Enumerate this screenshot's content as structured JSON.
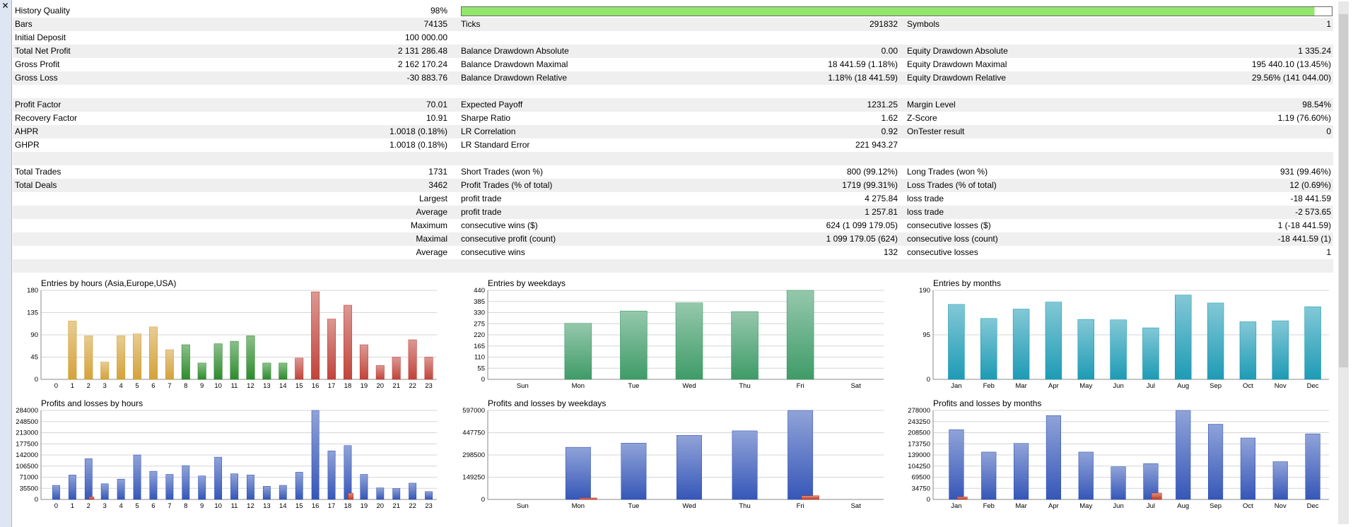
{
  "window": {
    "close_label": "✕"
  },
  "history_quality": {
    "label": "History Quality",
    "value": "98%",
    "fill_fraction": 0.98,
    "bar_color": "#93e66b"
  },
  "rows": [
    {
      "cells": [
        "Bars",
        "74135",
        "Ticks",
        "291832",
        "Symbols",
        "1"
      ]
    },
    {
      "cells": [
        "Initial Deposit",
        "100 000.00",
        "",
        "",
        "",
        ""
      ]
    },
    {
      "cells": [
        "Total Net Profit",
        "2 131 286.48",
        "Balance Drawdown Absolute",
        "0.00",
        "Equity Drawdown Absolute",
        "1 335.24"
      ]
    },
    {
      "cells": [
        "Gross Profit",
        "2 162 170.24",
        "Balance Drawdown Maximal",
        "18 441.59 (1.18%)",
        "Equity Drawdown Maximal",
        "195 440.10 (13.45%)"
      ]
    },
    {
      "cells": [
        "Gross Loss",
        "-30 883.76",
        "Balance Drawdown Relative",
        "1.18% (18 441.59)",
        "Equity Drawdown Relative",
        "29.56% (141 044.00)"
      ]
    },
    {
      "cells": [
        "",
        "",
        "",
        "",
        "",
        ""
      ]
    },
    {
      "cells": [
        "Profit Factor",
        "70.01",
        "Expected Payoff",
        "1231.25",
        "Margin Level",
        "98.54%"
      ]
    },
    {
      "cells": [
        "Recovery Factor",
        "10.91",
        "Sharpe Ratio",
        "1.62",
        "Z-Score",
        "1.19 (76.60%)"
      ]
    },
    {
      "cells": [
        "AHPR",
        "1.0018 (0.18%)",
        "LR Correlation",
        "0.92",
        "OnTester result",
        "0"
      ]
    },
    {
      "cells": [
        "GHPR",
        "1.0018 (0.18%)",
        "LR Standard Error",
        "221 943.27",
        "",
        ""
      ]
    },
    {
      "cells": [
        "",
        "",
        "",
        "",
        "",
        ""
      ]
    },
    {
      "cells": [
        "Total Trades",
        "1731",
        "Short Trades (won %)",
        "800 (99.12%)",
        "Long Trades (won %)",
        "931 (99.46%)"
      ]
    },
    {
      "cells": [
        "Total Deals",
        "3462",
        "Profit Trades (% of total)",
        "1719 (99.31%)",
        "Loss Trades (% of total)",
        "12 (0.69%)"
      ]
    },
    {
      "cells": [
        "",
        "Largest",
        "profit trade",
        "4 275.84",
        "loss trade",
        "-18 441.59"
      ]
    },
    {
      "cells": [
        "",
        "Average",
        "profit trade",
        "1 257.81",
        "loss trade",
        "-2 573.65"
      ]
    },
    {
      "cells": [
        "",
        "Maximum",
        "consecutive wins ($)",
        "624 (1 099 179.05)",
        "consecutive losses ($)",
        "1 (-18 441.59)"
      ]
    },
    {
      "cells": [
        "",
        "Maximal",
        "consecutive profit (count)",
        "1 099 179.05 (624)",
        "consecutive loss (count)",
        "-18 441.59 (1)"
      ]
    },
    {
      "cells": [
        "",
        "Average",
        "consecutive wins",
        "132",
        "consecutive losses",
        "1"
      ]
    },
    {
      "cells": [
        "",
        "",
        "",
        "",
        "",
        ""
      ]
    }
  ],
  "chart_data": [
    {
      "type": "bar",
      "title": "Entries by hours (Asia,Europe,USA)",
      "categories": [
        "0",
        "1",
        "2",
        "3",
        "4",
        "5",
        "6",
        "7",
        "8",
        "9",
        "10",
        "11",
        "12",
        "13",
        "14",
        "15",
        "16",
        "17",
        "18",
        "19",
        "20",
        "21",
        "22",
        "23"
      ],
      "values": [
        0,
        118,
        88,
        35,
        88,
        92,
        106,
        60,
        70,
        33,
        72,
        77,
        88,
        33,
        33,
        43,
        177,
        122,
        150,
        70,
        28,
        45,
        80,
        45
      ],
      "yticks": [
        "0",
        "45",
        "90",
        "135",
        "180"
      ],
      "ylim": [
        0,
        180
      ],
      "colors": [
        "#d4a23a",
        "#d4a23a",
        "#d4a23a",
        "#d4a23a",
        "#d4a23a",
        "#d4a23a",
        "#d4a23a",
        "#d4a23a",
        "#2e8b2e",
        "#2e8b2e",
        "#2e8b2e",
        "#2e8b2e",
        "#2e8b2e",
        "#2e8b2e",
        "#2e8b2e",
        "#c0443a",
        "#c0443a",
        "#c0443a",
        "#c0443a",
        "#c0443a",
        "#c0443a",
        "#c0443a",
        "#c0443a",
        "#c0443a"
      ]
    },
    {
      "type": "bar",
      "title": "Entries by weekdays",
      "categories": [
        "Sun",
        "Mon",
        "Tue",
        "Wed",
        "Thu",
        "Fri",
        "Sat"
      ],
      "values": [
        0,
        277,
        338,
        378,
        335,
        440,
        0
      ],
      "yticks": [
        "0",
        "55",
        "110",
        "165",
        "220",
        "275",
        "330",
        "385",
        "440"
      ],
      "ylim": [
        0,
        440
      ],
      "colors": [
        "#3f9b68"
      ]
    },
    {
      "type": "bar",
      "title": "Entries by months",
      "categories": [
        "Jan",
        "Feb",
        "Mar",
        "Apr",
        "May",
        "Jun",
        "Jul",
        "Aug",
        "Sep",
        "Oct",
        "Nov",
        "Dec"
      ],
      "values": [
        160,
        130,
        150,
        165,
        128,
        127,
        110,
        180,
        163,
        123,
        125,
        155
      ],
      "yticks": [
        "0",
        "95",
        "190"
      ],
      "ylim": [
        0,
        190
      ],
      "colors": [
        "#1e9bb5"
      ]
    },
    {
      "type": "bar",
      "title": "Profits and losses by hours",
      "categories": [
        "0",
        "1",
        "2",
        "3",
        "4",
        "5",
        "6",
        "7",
        "8",
        "9",
        "10",
        "11",
        "12",
        "13",
        "14",
        "15",
        "16",
        "17",
        "18",
        "19",
        "20",
        "21",
        "22",
        "23"
      ],
      "series": [
        {
          "values": [
            45000,
            78000,
            130000,
            50000,
            65000,
            142000,
            90000,
            80000,
            108000,
            75000,
            135000,
            82000,
            78000,
            42000,
            45000,
            87000,
            284000,
            155000,
            172000,
            80000,
            37000,
            35000,
            52000,
            25000
          ]
        },
        {
          "values": [
            0,
            0,
            8000,
            0,
            0,
            0,
            0,
            0,
            0,
            0,
            0,
            0,
            0,
            0,
            0,
            0,
            0,
            0,
            20000,
            0,
            0,
            0,
            0,
            0
          ]
        }
      ],
      "yticks": [
        "0",
        "35500",
        "71000",
        "106500",
        "142000",
        "177500",
        "213000",
        "248500",
        "284000"
      ],
      "ylim": [
        0,
        284000
      ],
      "colors": [
        "#3657b8",
        "#c03a24"
      ]
    },
    {
      "type": "bar",
      "title": "Profits and losses by weekdays",
      "categories": [
        "Sun",
        "Mon",
        "Tue",
        "Wed",
        "Thu",
        "Fri",
        "Sat"
      ],
      "series": [
        {
          "values": [
            0,
            350000,
            378000,
            430000,
            460000,
            597000,
            0
          ]
        },
        {
          "values": [
            0,
            10000,
            0,
            0,
            0,
            25000,
            0
          ]
        }
      ],
      "yticks": [
        "0",
        "149250",
        "298500",
        "447750",
        "597000"
      ],
      "ylim": [
        0,
        597000
      ],
      "colors": [
        "#3657b8",
        "#c03a24"
      ]
    },
    {
      "type": "bar",
      "title": "Profits and losses by months",
      "categories": [
        "Jan",
        "Feb",
        "Mar",
        "Apr",
        "May",
        "Jun",
        "Jul",
        "Aug",
        "Sep",
        "Oct",
        "Nov",
        "Dec"
      ],
      "series": [
        {
          "values": [
            218000,
            148000,
            175000,
            262000,
            148000,
            102000,
            112000,
            278000,
            235000,
            192000,
            118000,
            205000
          ]
        },
        {
          "values": [
            8000,
            0,
            0,
            0,
            0,
            0,
            20000,
            0,
            0,
            0,
            0,
            0
          ]
        }
      ],
      "yticks": [
        "0",
        "34750",
        "69500",
        "104250",
        "139000",
        "173750",
        "208500",
        "243250",
        "278000"
      ],
      "ylim": [
        0,
        278000
      ],
      "colors": [
        "#3657b8",
        "#c03a24"
      ]
    }
  ]
}
